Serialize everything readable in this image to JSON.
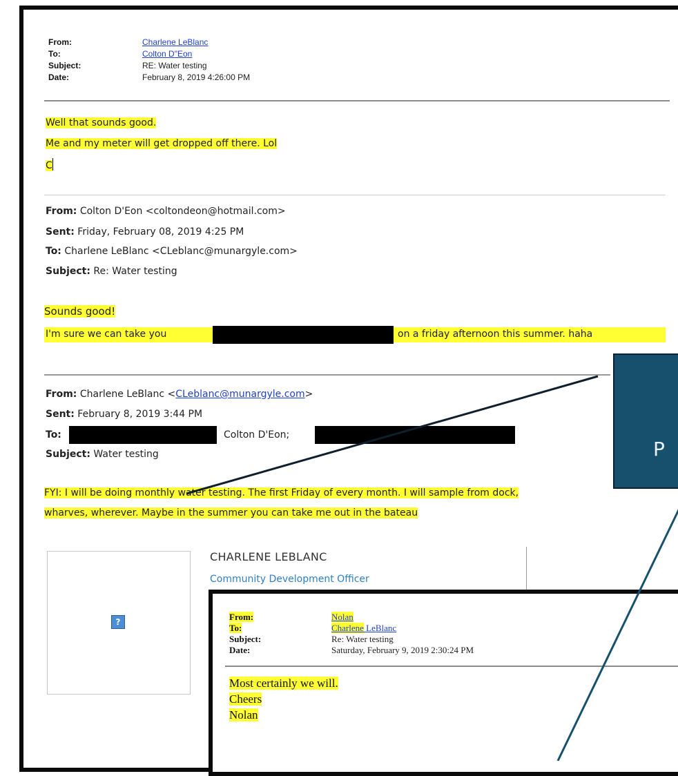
{
  "email1": {
    "labels": {
      "from": "From:",
      "to": "To:",
      "subject": "Subject:",
      "date": "Date:"
    },
    "from": "Charlene LeBlanc",
    "to": "Colton D\"Eon",
    "subject": "RE: Water testing",
    "date": "February 8, 2019 4:26:00 PM",
    "body": [
      "Well that sounds good.",
      "Me and my meter will get dropped off there.  Lol",
      "C"
    ]
  },
  "email2": {
    "from_label": "From:",
    "from": "Colton D'Eon <coltondeon@hotmail.com>",
    "sent_label": "Sent:",
    "sent": "Friday, February 08, 2019 4:25 PM",
    "to_label": "To:",
    "to": "Charlene LeBlanc <CLeblanc@munargyle.com>",
    "subject_label": "Subject:",
    "subject": "Re: Water testing",
    "body_line1": "Sounds good!",
    "body_line2_a": "I'm sure we can take you",
    "body_line2_b": "on a friday afternoon this summer. haha"
  },
  "email3": {
    "from_label": "From:",
    "from_name": "Charlene LeBlanc <",
    "from_email": "CLeblanc@munargyle.com",
    "from_close": ">",
    "sent_label": "Sent:",
    "sent": "February 8, 2019 3:44 PM",
    "to_label": "To:",
    "to_mid": "Colton D'Eon;",
    "subject_label": "Subject:",
    "subject": "Water testing",
    "body_line1": "FYI:  I will be doing monthly water testing. The first Friday of every month. I will sample from dock,",
    "body_line2": "wharves, wherever. Maybe in the summer you can take me out in the bateau"
  },
  "signature": {
    "name": "CHARLENE LEBLANC",
    "title": "Community Development Officer",
    "logo_icon": "broken-image-icon"
  },
  "overlay": {
    "letter": "P",
    "color": "#17506d"
  },
  "inset": {
    "labels": {
      "from": "From:",
      "to": "To:",
      "subject": "Subject:",
      "date": "Date:"
    },
    "from": "Nolan",
    "to_a": "Charlene",
    "to_b": " LeBlanc",
    "subject": "Re: Water testing",
    "date": "Saturday, February 9, 2019 2:30:24 PM",
    "body": [
      "Most certainly we will.",
      "Cheers",
      "Nolan"
    ]
  },
  "colors": {
    "highlight": "#ffff33",
    "link": "#1f3fd1",
    "frame": "#0b0b0b",
    "redaction": "#000000"
  }
}
